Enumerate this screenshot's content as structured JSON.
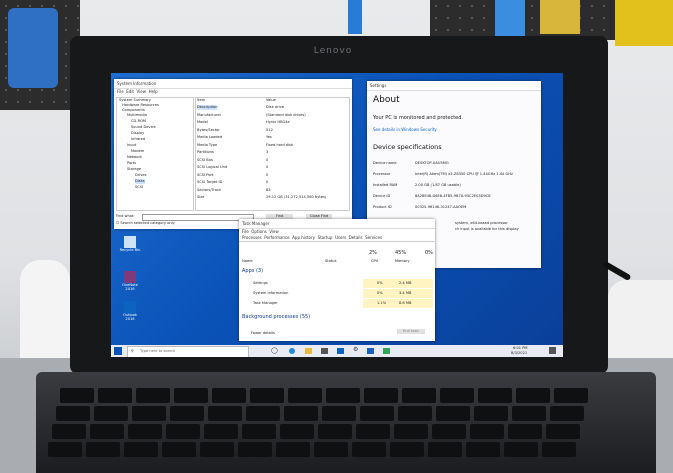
{
  "laptop": {
    "brand": "Lenovo"
  },
  "sysinfo": {
    "title": "System Information",
    "menu": [
      "File",
      "Edit",
      "View",
      "Help"
    ],
    "tree": [
      "System Summary",
      "Hardware Resources",
      "Components",
      "Multimedia",
      "CD-ROM",
      "Sound Device",
      "Display",
      "Infrared",
      "Input",
      "Modem",
      "Network",
      "Ports",
      "Storage",
      "Drives",
      "Disks",
      "SCSI"
    ],
    "col_item": "Item",
    "col_value": "Value",
    "rows": [
      [
        "Description",
        "Disk drive"
      ],
      [
        "Manufacturer",
        "(Standard disk drives)"
      ],
      [
        "Model",
        "Hynix HBG4e"
      ],
      [
        "Bytes/Sector",
        "512"
      ],
      [
        "Media Loaded",
        "Yes"
      ],
      [
        "Media Type",
        "Fixed hard disk"
      ],
      [
        "Partitions",
        "3"
      ],
      [
        "SCSI Bus",
        "0"
      ],
      [
        "SCSI Logical Unit",
        "0"
      ],
      [
        "SCSI Port",
        "0"
      ],
      [
        "SCSI Target ID",
        "0"
      ],
      [
        "Sectors/Track",
        "63"
      ],
      [
        "Size",
        "29.12 GB (31,272,514,560 bytes)"
      ]
    ],
    "find_label": "Find what:",
    "find_button": "Find",
    "close_find": "Close Find",
    "search_check": "Search selected category only"
  },
  "settings": {
    "title": "Settings",
    "heading": "About",
    "status": "Your PC is monitored and protected.",
    "link": "See details in Windows Security",
    "spec_heading": "Device specifications",
    "specs": [
      [
        "Device name",
        "DESKTOP-UAU5MG"
      ],
      [
        "Processor",
        "Intel(R) Atom(TM) x5-Z8350  CPU @ 1.44GHz   1.44 GHz"
      ],
      [
        "Installed RAM",
        "2.00 GB (1.87 GB usable)"
      ],
      [
        "Device ID",
        "8A28E48-D6E8-4FB5-9B7A-93C2E03D9C8"
      ],
      [
        "Product ID",
        "00325-96146-31247-AAOEM"
      ]
    ],
    "extra1": "system, x64-based processor",
    "extra2": "ch input is available for this display"
  },
  "taskmgr": {
    "title": "Task Manager",
    "menu": [
      "File",
      "Options",
      "View"
    ],
    "tabs": [
      "Processes",
      "Performance",
      "App history",
      "Startup",
      "Users",
      "Details",
      "Services"
    ],
    "col_name": "Name",
    "col_status": "Status",
    "cpu_pct": "2%",
    "cpu_label": "CPU",
    "mem_pct": "45%",
    "mem_label": "Memory",
    "disk_pct": "0%",
    "apps_heading": "Apps (3)",
    "apps": [
      {
        "name": "Settings",
        "cpu": "0%",
        "mem": "2.4 MB"
      },
      {
        "name": "System Information",
        "cpu": "0%",
        "mem": "3.4 MB"
      },
      {
        "name": "Task Manager",
        "cpu": "1.1%",
        "mem": "8.6 MB"
      }
    ],
    "bg_heading": "Background processes (55)",
    "fewer": "Fewer details",
    "end_task": "End task"
  },
  "desktop": {
    "icons": [
      "Recycle Bin",
      "Microsoft Edge",
      "OneNote 2016",
      "Outlook 2016"
    ]
  },
  "taskbar": {
    "search_placeholder": "Type here to search",
    "time": "6:01 PM",
    "date": "8/3/2021"
  },
  "colors": {
    "win_blue": "#0b53b8",
    "taskmgr_highlight": "#fff4c2",
    "settings_bg": "#ffffff"
  }
}
